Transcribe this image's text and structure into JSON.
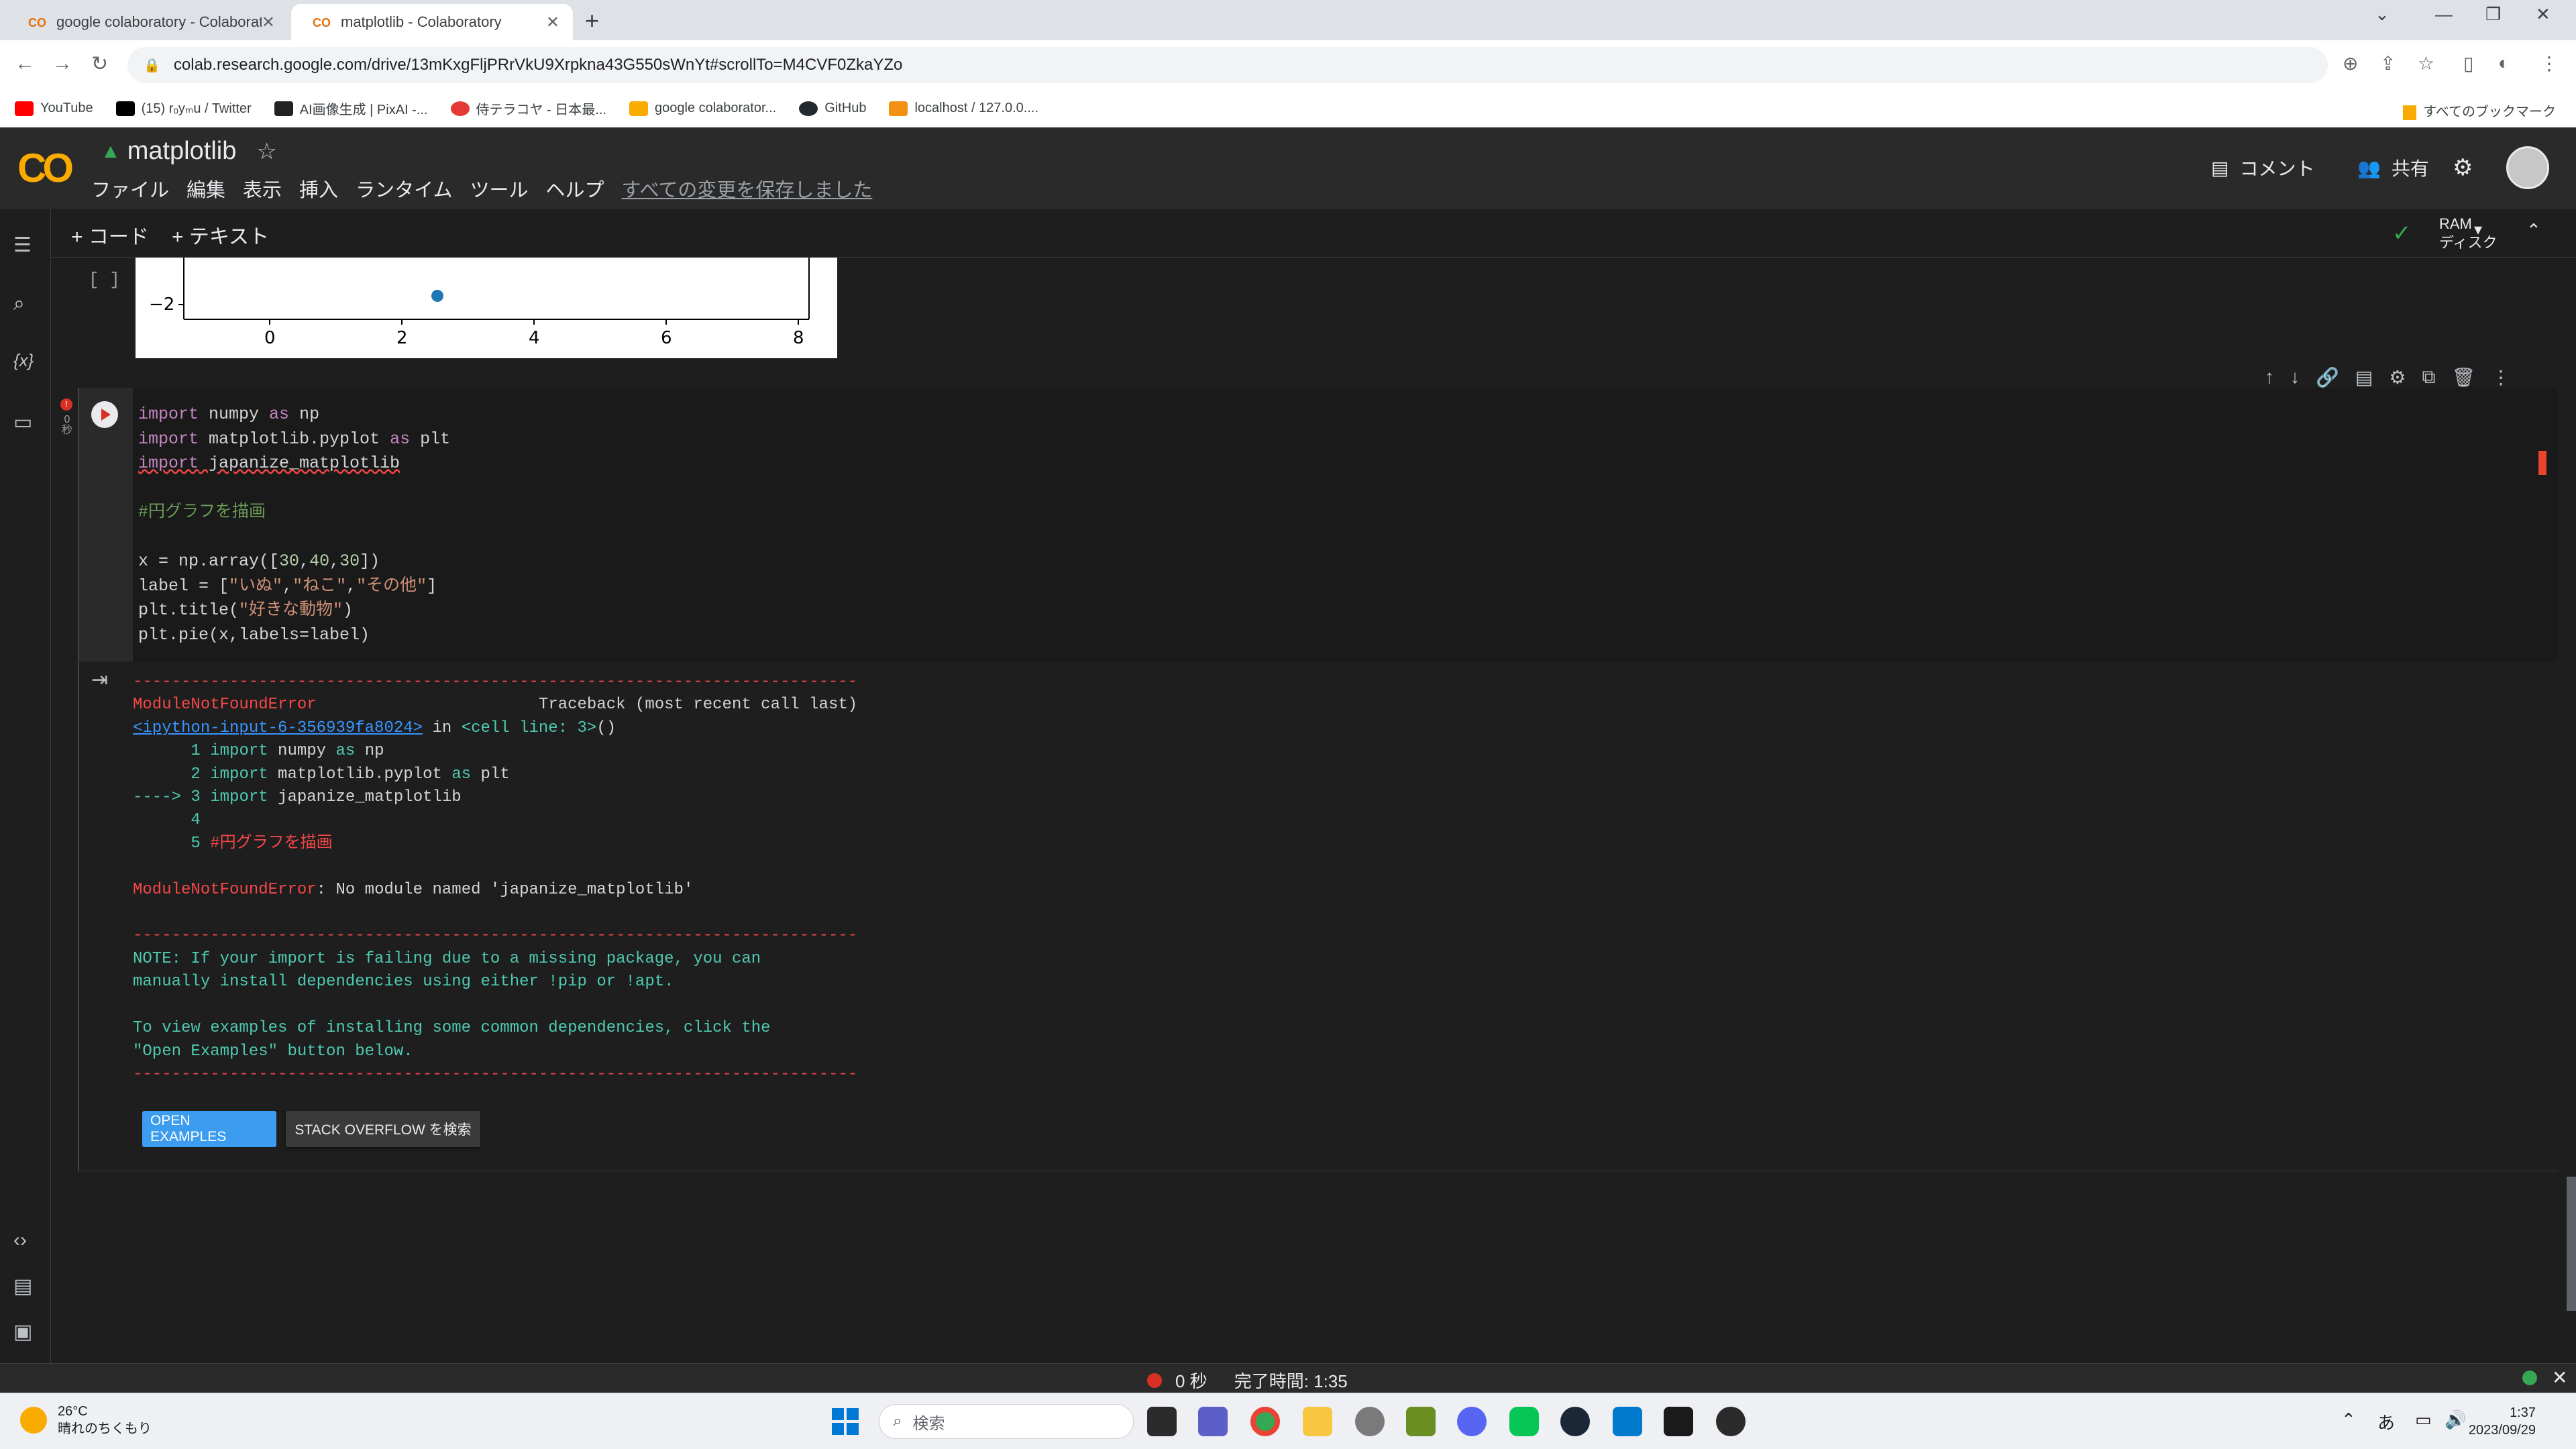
{
  "browser": {
    "tabs": [
      {
        "title": "google colaboratory - Colaborato",
        "active": false
      },
      {
        "title": "matplotlib - Colaboratory",
        "active": true
      }
    ],
    "url": "colab.research.google.com/drive/13mKxgFljPRrVkU9Xrpkna43G550sWnYt#scrollTo=M4CVF0ZkaYZo",
    "bookmarks": [
      {
        "label": "YouTube",
        "color": "#ff0000"
      },
      {
        "label": "(15) rₒyₘu / Twitter",
        "color": "#000000"
      },
      {
        "label": "AI画像生成 | PixAI -...",
        "color": "#222222"
      },
      {
        "label": "侍テラコヤ - 日本最...",
        "color": "#e53935"
      },
      {
        "label": "google colaborator...",
        "color": "#f9ab00"
      },
      {
        "label": "GitHub",
        "color": "#24292e"
      },
      {
        "label": "localhost / 127.0.0....",
        "color": "#f29111"
      }
    ],
    "bookmarks_right": "すべてのブックマーク"
  },
  "colab": {
    "notebook_title": "matplotlib",
    "menus": [
      "ファイル",
      "編集",
      "表示",
      "挿入",
      "ランタイム",
      "ツール",
      "ヘルプ"
    ],
    "saved_status": "すべての変更を保存しました",
    "comment_label": "コメント",
    "share_label": "共有",
    "add_code": "+ コード",
    "add_text": "+ テキスト",
    "ram_label": "RAM",
    "disk_label": "ディスク"
  },
  "prev_cell": {
    "bracket": "[ ]",
    "y_tick": "−2",
    "x_ticks": [
      "0",
      "2",
      "4",
      "6",
      "8"
    ]
  },
  "code_cell": {
    "exec_time": "0\n秒"
  },
  "output": {
    "open_examples": "OPEN EXAMPLES",
    "stack_overflow": "STACK OVERFLOW を検索"
  },
  "statusbar": {
    "time": "0 秒",
    "completed": "完了時間: 1:35"
  },
  "taskbar": {
    "temp": "26°C",
    "weather": "晴れのちくもり",
    "search": "検索",
    "ime": "あ",
    "time": "1:37",
    "date": "2023/09/29"
  }
}
